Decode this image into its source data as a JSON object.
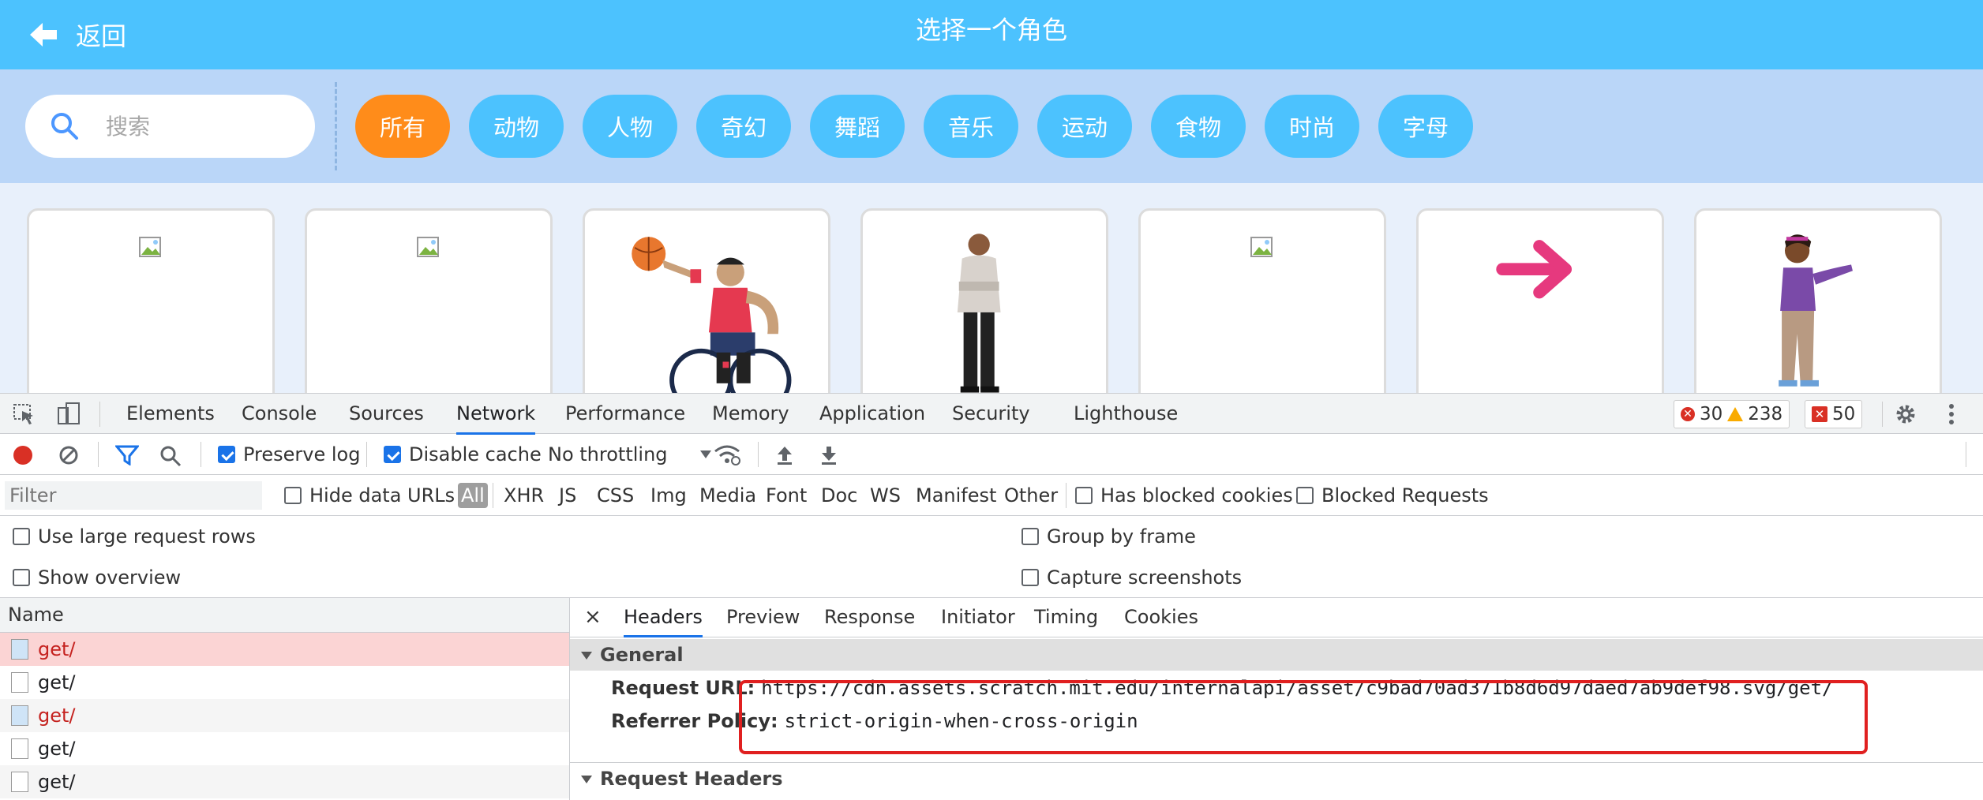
{
  "library": {
    "back_label": "返回",
    "title": "选择一个角色",
    "search_placeholder": "搜索",
    "tags": [
      {
        "label": "所有",
        "active": true
      },
      {
        "label": "动物"
      },
      {
        "label": "人物"
      },
      {
        "label": "奇幻"
      },
      {
        "label": "舞蹈"
      },
      {
        "label": "音乐"
      },
      {
        "label": "运动"
      },
      {
        "label": "食物"
      },
      {
        "label": "时尚"
      },
      {
        "label": "字母"
      }
    ],
    "colors": {
      "topbar": "#4cc2fe",
      "active_tag": "#ff8c1a",
      "filterbar": "#bad6f8"
    }
  },
  "devtools": {
    "tabs": [
      "Elements",
      "Console",
      "Sources",
      "Network",
      "Performance",
      "Memory",
      "Application",
      "Security",
      "Lighthouse"
    ],
    "active_tab": "Network",
    "errors": "30",
    "warnings": "238",
    "issues": "50",
    "toolbar": {
      "preserve_log": "Preserve log",
      "disable_cache": "Disable cache",
      "throttling": "No throttling"
    },
    "filter": {
      "placeholder": "Filter",
      "hide_data_urls": "Hide data URLs",
      "types": [
        "All",
        "XHR",
        "JS",
        "CSS",
        "Img",
        "Media",
        "Font",
        "Doc",
        "WS",
        "Manifest",
        "Other"
      ],
      "has_blocked_cookies": "Has blocked cookies",
      "blocked_requests": "Blocked Requests"
    },
    "options": {
      "large_rows": "Use large request rows",
      "group_by_frame": "Group by frame",
      "show_overview": "Show overview",
      "capture_screenshots": "Capture screenshots"
    },
    "requests": {
      "header": "Name",
      "rows": [
        "get/",
        "get/",
        "get/",
        "get/",
        "get/"
      ]
    },
    "detail": {
      "close": "×",
      "tabs": [
        "Headers",
        "Preview",
        "Response",
        "Initiator",
        "Timing",
        "Cookies"
      ],
      "general_title": "General",
      "request_url_label": "Request URL:",
      "request_url": "https://cdn.assets.scratch.mit.edu/internalapi/asset/c9bad70ad371b8d6d97daed7ab9def98.svg/get/",
      "referrer_policy_label": "Referrer Policy:",
      "referrer_policy": "strict-origin-when-cross-origin",
      "request_headers_title": "Request Headers"
    }
  }
}
